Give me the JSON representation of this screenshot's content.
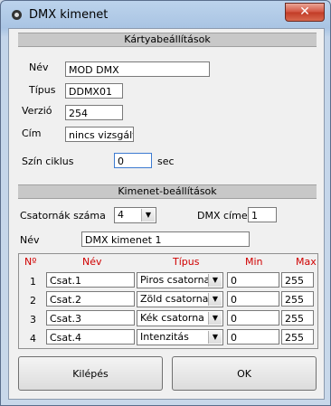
{
  "window": {
    "title": "DMX kimenet",
    "close_symbol": "✕"
  },
  "card_settings": {
    "header": "Kártyabeállítások",
    "name_label": "Név",
    "name_value": "MOD DMX",
    "type_label": "Típus",
    "type_value": "DDMX01",
    "version_label": "Verzió",
    "version_value": "254",
    "address_label": "Cím",
    "address_value": "nincs vizsgálva",
    "color_cycle_label": "Szín ciklus",
    "color_cycle_value": "0",
    "color_cycle_unit": "sec"
  },
  "output_settings": {
    "header": "Kimenet-beállítások",
    "channels_label": "Csatornák száma",
    "channels_value": "4",
    "dmx_address_label": "DMX címek",
    "dmx_address_value": "1",
    "name_label": "Név",
    "name_value": "DMX kimenet 1"
  },
  "channel_table": {
    "columns": [
      "Nº",
      "Név",
      "Típus",
      "Min",
      "Max"
    ],
    "rows": [
      {
        "num": "1",
        "name": "Csat.1",
        "type": "Piros csatorna",
        "min": "0",
        "max": "255"
      },
      {
        "num": "2",
        "name": "Csat.2",
        "type": "Zöld csatorna",
        "min": "0",
        "max": "255"
      },
      {
        "num": "3",
        "name": "Csat.3",
        "type": "Kék csatorna",
        "min": "0",
        "max": "255"
      },
      {
        "num": "4",
        "name": "Csat.4",
        "type": "Intenzitás",
        "min": "0",
        "max": "255"
      }
    ]
  },
  "buttons": {
    "exit": "Kilépés",
    "ok": "OK"
  },
  "colors": {
    "column_header": "#d00000",
    "section_header": "#c8c8c8"
  }
}
